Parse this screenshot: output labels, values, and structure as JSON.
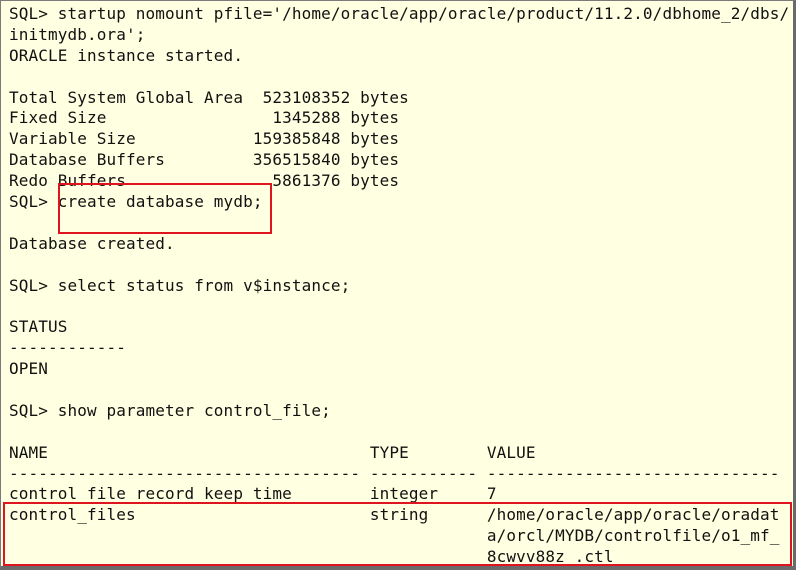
{
  "terminal": {
    "colors": {
      "background": "#ffffe1",
      "highlight": "#e0141e"
    },
    "lines": [
      "SQL> startup nomount pfile='/home/oracle/app/oracle/product/11.2.0/dbhome_2/dbs/",
      "initmydb.ora';",
      "ORACLE instance started.",
      "",
      "Total System Global Area  523108352 bytes",
      "Fixed Size                 1345288 bytes",
      "Variable Size            159385848 bytes",
      "Database Buffers         356515840 bytes",
      "Redo Buffers               5861376 bytes",
      "SQL> create database mydb;",
      "",
      "Database created.",
      "",
      "SQL> select status from v$instance;",
      "",
      "STATUS",
      "------------",
      "OPEN",
      "",
      "SQL> show parameter control_file;",
      "",
      "NAME                                 TYPE        VALUE",
      "------------------------------------ ----------- ------------------------------",
      "control_file_record_keep_time        integer     7",
      "control_files                        string      /home/oracle/app/oracle/oradat",
      "                                                 a/orcl/MYDB/controlfile/o1_mf_",
      "                                                 8cwvv88z_.ctl"
    ]
  }
}
